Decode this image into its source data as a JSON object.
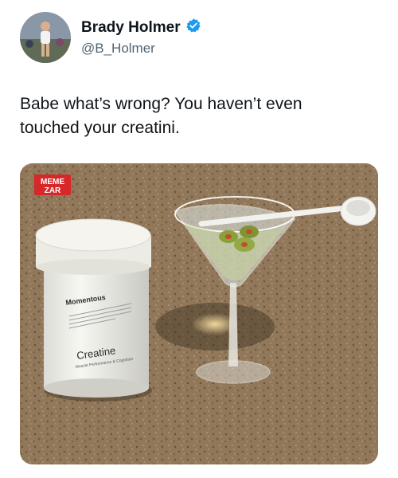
{
  "author": {
    "name": "Brady Holmer",
    "handle": "@B_Holmer",
    "verified": true,
    "verified_badge_color": "#1d9bf0"
  },
  "tweet": {
    "text_line1": "Babe what’s wrong? You haven’t even",
    "text_line2": "touched your creatini."
  },
  "image": {
    "watermark_line1": "MEME",
    "watermark_line2": "ZAR",
    "jar_brand": "Momentous",
    "jar_product": "Creatine",
    "jar_subtitle": "Muscle Performance & Cognition"
  },
  "colors": {
    "text": "#0f1419",
    "secondary_text": "#536471",
    "countertop": "#9b8060",
    "watermark": "#d62828"
  }
}
